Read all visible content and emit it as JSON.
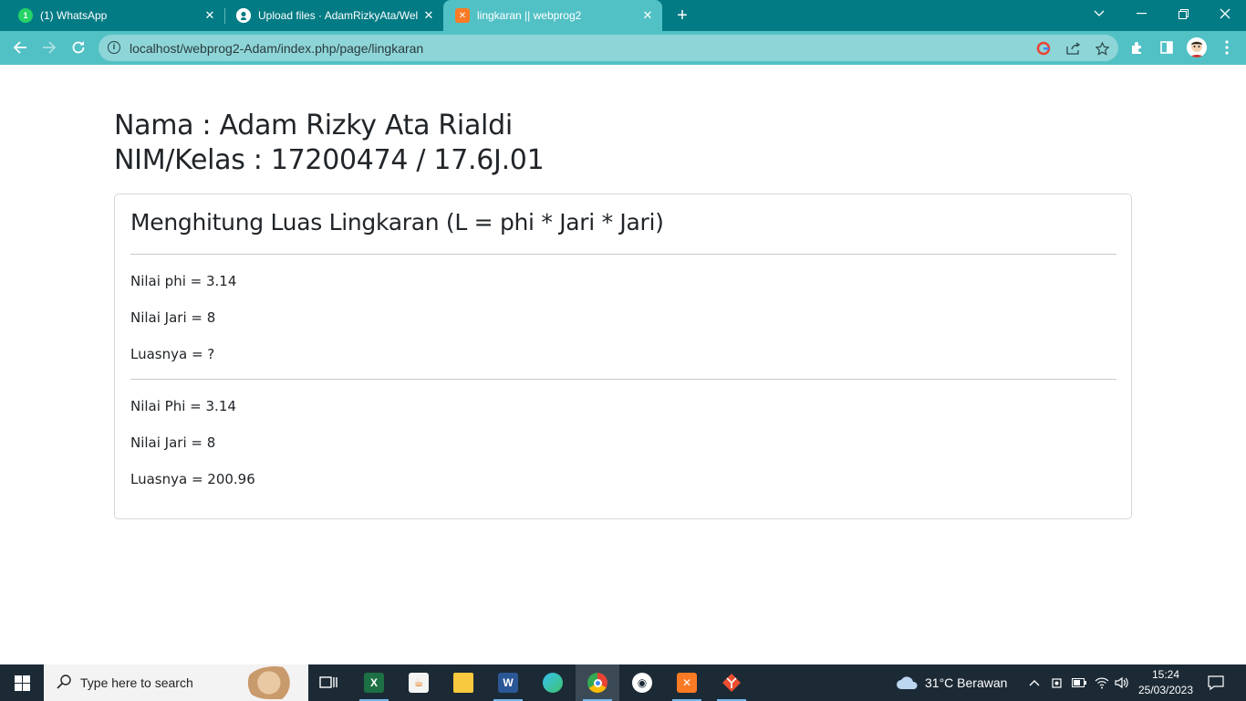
{
  "browser": {
    "tabs": [
      {
        "title": "(1) WhatsApp",
        "favicon": "whatsapp-icon",
        "active": false
      },
      {
        "title": "Upload files · AdamRizkyAta/Wel",
        "favicon": "github-icon",
        "active": false
      },
      {
        "title": "lingkaran || webprog2",
        "favicon": "xampp-icon",
        "active": true
      }
    ],
    "close_glyph": "✕",
    "new_tab_glyph": "+",
    "url": "localhost/webprog2-Adam/index.php/page/lingkaran",
    "colors": {
      "tabstrip": "#037b84",
      "toolbar": "#52c1c5",
      "omnibox": "#8ed5d8"
    }
  },
  "page": {
    "name_line": "Nama : Adam Rizky Ata Rialdi",
    "nim_line": "NIM/Kelas : 17200474 / 17.6J.01",
    "card": {
      "title": "Menghitung Luas Lingkaran (L = phi * Jari * Jari)",
      "section1": [
        "Nilai phi = 3.14",
        "Nilai Jari = 8",
        "Luasnya = ?"
      ],
      "section2": [
        "Nilai Phi = 3.14",
        "Nilai Jari = 8",
        "Luasnya = 200.96"
      ]
    }
  },
  "taskbar": {
    "search_placeholder": "Type here to search",
    "weather": "31°C  Berawan",
    "time": "15:24",
    "date": "25/03/2023",
    "apps": [
      "task-view-icon",
      "excel-icon",
      "java-icon",
      "file-explorer-icon",
      "word-icon",
      "edge-icon",
      "chrome-icon",
      "app-icon",
      "xampp-icon",
      "git-icon"
    ]
  }
}
